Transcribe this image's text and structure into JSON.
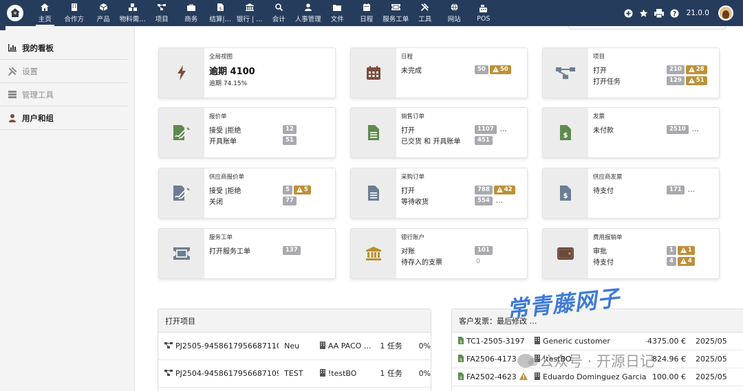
{
  "topbar": {
    "menu": [
      {
        "label": "主页",
        "icon": "home-icon"
      },
      {
        "label": "合作方",
        "icon": "building-icon"
      },
      {
        "label": "产品",
        "icon": "cube-icon"
      },
      {
        "label": "物料需…",
        "icon": "cubes-icon"
      },
      {
        "label": "项目",
        "icon": "project-icon"
      },
      {
        "label": "商务",
        "icon": "briefcase-icon"
      },
      {
        "label": "结算|…",
        "icon": "invoice-icon"
      },
      {
        "label": "银行 | …",
        "icon": "bank-icon"
      },
      {
        "label": "会计",
        "icon": "search-dollar-icon"
      },
      {
        "label": "人事管理",
        "icon": "user-tie-icon"
      },
      {
        "label": "文件",
        "icon": "folder-icon"
      },
      {
        "label": "日程",
        "icon": "calendar-icon"
      },
      {
        "label": "服务工单",
        "icon": "ticket-icon"
      },
      {
        "label": "工具",
        "icon": "tools-icon"
      },
      {
        "label": "网站",
        "icon": "globe-icon"
      },
      {
        "label": "POS",
        "icon": "cash-register-icon"
      }
    ],
    "version": "21.0.0"
  },
  "sidebar": {
    "items": [
      {
        "label": "我的看板",
        "icon": "chart-bar-icon"
      },
      {
        "label": "设置",
        "icon": "wrench-icon"
      },
      {
        "label": "管理工具",
        "icon": "server-icon"
      },
      {
        "label": "用户和组",
        "icon": "user-icon"
      }
    ]
  },
  "boxes": {
    "global": {
      "title": "全局视图",
      "big": "逾期 4100",
      "sub": "逾期 74.15%"
    },
    "agenda": {
      "title": "日程",
      "row1": "未完成",
      "b1": "50",
      "w1": "50"
    },
    "project": {
      "title": "项目",
      "row1": "打开",
      "b1": "210",
      "w1": "28",
      "row2": "打开任务",
      "b2": "129",
      "w2": "51"
    },
    "proposal": {
      "title": "报价单",
      "row1": "接受 |拒绝",
      "b1": "12",
      "row2": "开具账单",
      "b2": "51"
    },
    "order": {
      "title": "销售订单",
      "row1": "打开",
      "b1": "1107",
      "d1": "…",
      "row2": "已交货 和 开具账单",
      "b2": "451"
    },
    "invoice": {
      "title": "发票",
      "row1": "未付款",
      "b1": "2510",
      "d1": "…"
    },
    "supplier_proposal": {
      "title": "供应商报价单",
      "row1": "接受 |拒绝",
      "b1": "5",
      "w1": "5",
      "row2": "关闭",
      "b2": "77"
    },
    "purchase_order": {
      "title": "采购订单",
      "row1": "打开",
      "b1": "788",
      "w1": "42",
      "row2": "等待收货",
      "b2": "554",
      "d2": "…"
    },
    "supplier_invoice": {
      "title": "供应商发票",
      "row1": "待支付",
      "b1": "171",
      "d1": "…"
    },
    "ticket": {
      "title": "服务工单",
      "row1": "打开服务工单",
      "b1": "137"
    },
    "bank": {
      "title": "银行账户",
      "row1": "对账",
      "b1": "101",
      "row2": "待存入的支票",
      "z2": "0"
    },
    "expense": {
      "title": "费用报销单",
      "row1": "审批",
      "b1": "1",
      "w1": "1",
      "row2": "待支付",
      "b2": "4",
      "w2": "4"
    }
  },
  "projects_panel": {
    "title": "打开项目",
    "rows": [
      {
        "ref": "PJ2505-94586179566871103",
        "label": "Neu",
        "company": "AA PACO …",
        "tasks": "1 任务",
        "pct": "0%"
      },
      {
        "ref": "PJ2504-94586179566871099",
        "label": "TEST",
        "company": "!testBO",
        "tasks": "1 任务",
        "pct": "0%"
      }
    ]
  },
  "invoices_panel": {
    "title": "客户发票：最后修改 …",
    "rows": [
      {
        "ref": "TC1-2505-3197",
        "warn": false,
        "company": "Generic customer",
        "amount": "-4375.00 €",
        "date": "2025/05…"
      },
      {
        "ref": "FA2506-4173",
        "warn": false,
        "company": "!testBO",
        "amount": "824.96 €",
        "date": "2025/05…"
      },
      {
        "ref": "FA2502-4623",
        "warn": true,
        "company": "Eduardo Dominguez Garcia",
        "amount": "100.00 €",
        "date": "2025/05…"
      }
    ]
  },
  "watermark": {
    "title": "常青藤网子",
    "sub": "公众号 · 开源日记"
  },
  "colors": {
    "topbar": "#263c5c",
    "warn": "#bd9138",
    "badge": "#a9a9b0",
    "icon_brown": "#7a4e3c",
    "icon_green": "#5f8a4e",
    "icon_slate": "#6d7e92",
    "icon_gold": "#b8902e"
  }
}
